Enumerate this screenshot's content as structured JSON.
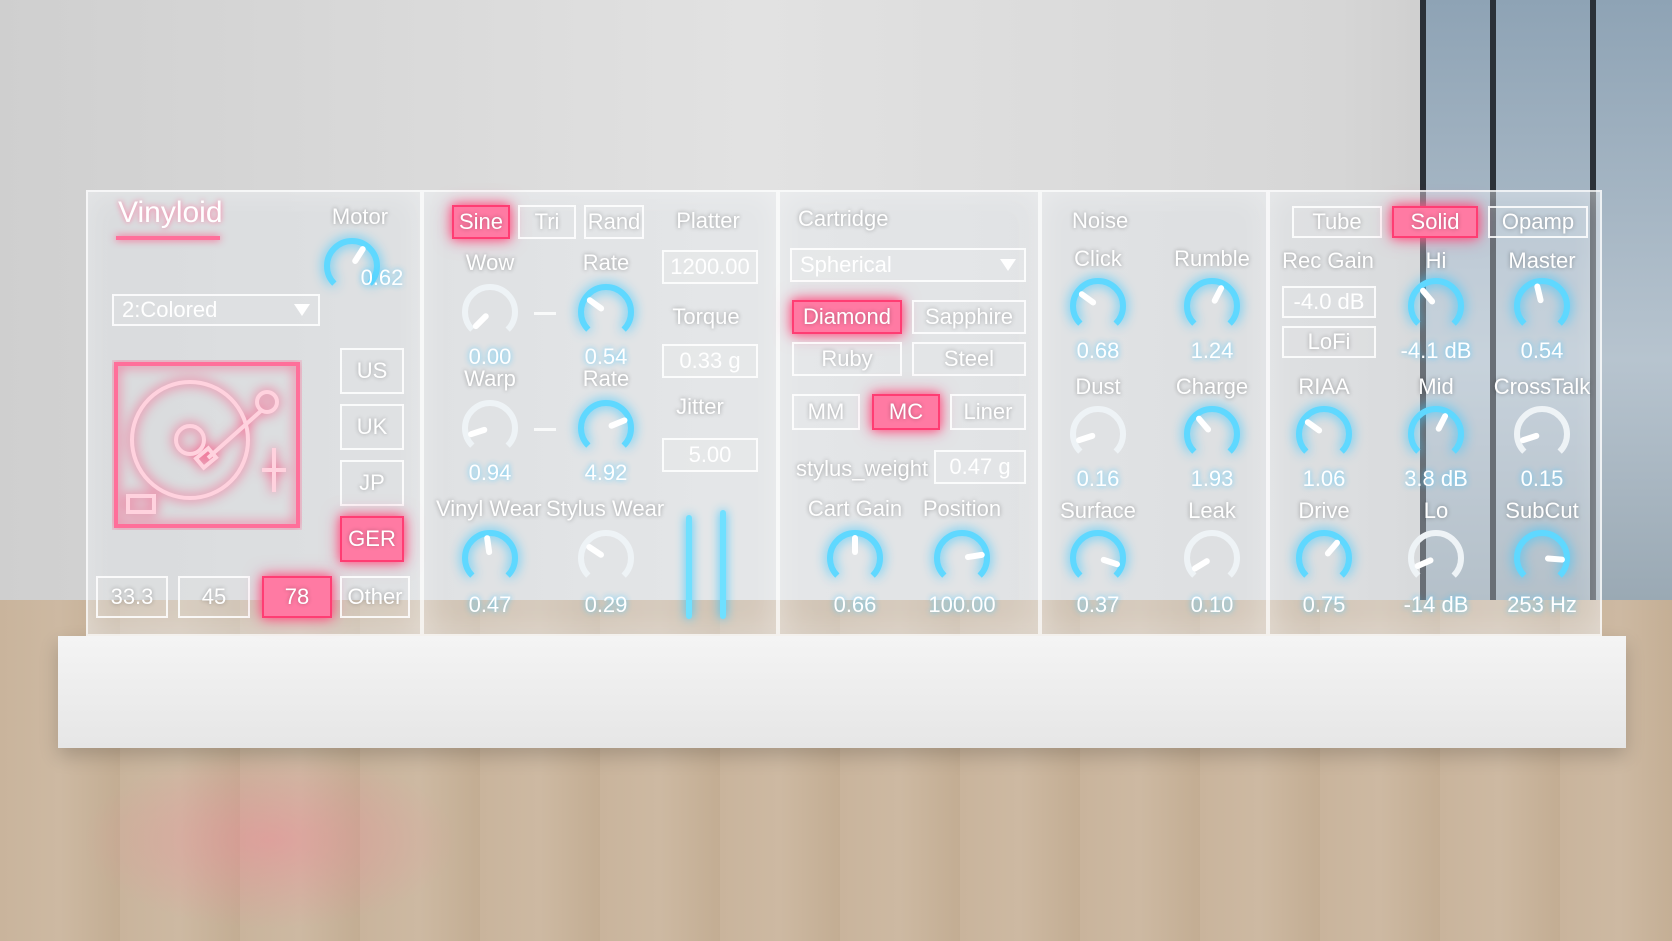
{
  "brand": {
    "title": "Vinyloid"
  },
  "motor": {
    "label": "Motor",
    "value": "0.62",
    "level": 0.62
  },
  "vinyl_type": {
    "selected": "2:Colored"
  },
  "region": {
    "buttons": [
      "US",
      "UK",
      "JP",
      "GER"
    ],
    "active": "GER"
  },
  "speed": {
    "buttons": [
      "33.3",
      "45",
      "78",
      "Other"
    ],
    "active": "78"
  },
  "lfo": {
    "buttons": [
      "Sine",
      "Tri",
      "Rand"
    ],
    "active": "Sine"
  },
  "platter": {
    "label": "Platter",
    "value": "1200.00",
    "torque_label": "Torque",
    "torque_value": "0.33 g",
    "jitter_label": "Jitter",
    "jitter_value": "5.00"
  },
  "wow": {
    "label": "Wow",
    "value": "0.00",
    "level": 0.0
  },
  "wow_rate": {
    "label": "Rate",
    "value": "0.54",
    "level": 0.3
  },
  "warp": {
    "label": "Warp",
    "value": "0.94",
    "level": 0.1
  },
  "warp_rate": {
    "label": "Rate",
    "value": "4.92",
    "level": 0.75
  },
  "vinyl_wear": {
    "label": "Vinyl Wear",
    "value": "0.47",
    "level": 0.47
  },
  "stylus_wear": {
    "label": "Stylus Wear",
    "value": "0.29",
    "level": 0.29
  },
  "cartridge": {
    "label": "Cartridge",
    "shape": "Spherical",
    "stylus_buttons": [
      "Diamond",
      "Sapphire",
      "Ruby",
      "Steel"
    ],
    "stylus_active": "Diamond",
    "type_buttons": [
      "MM",
      "MC",
      "Liner"
    ],
    "type_active": "MC",
    "weight_label": "stylus_weight",
    "weight_value": "0.47 g"
  },
  "cart_gain": {
    "label": "Cart Gain",
    "value": "0.66",
    "level": 0.5
  },
  "position": {
    "label": "Position",
    "value": "100.00",
    "level": 0.8
  },
  "noise": {
    "label": "Noise"
  },
  "click": {
    "label": "Click",
    "value": "0.68",
    "level": 0.3
  },
  "rumble": {
    "label": "Rumble",
    "value": "1.24",
    "level": 0.6
  },
  "dust": {
    "label": "Dust",
    "value": "0.16",
    "level": 0.1
  },
  "charge": {
    "label": "Charge",
    "value": "1.93",
    "level": 0.35
  },
  "surface": {
    "label": "Surface",
    "value": "0.37",
    "level": 0.9
  },
  "leak": {
    "label": "Leak",
    "value": "0.10",
    "level": 0.05
  },
  "circuit": {
    "buttons": [
      "Tube",
      "Solid",
      "Opamp"
    ],
    "active": "Solid"
  },
  "rec_gain": {
    "label": "Rec Gain",
    "value": "-4.0 dB",
    "lofi_label": "LoFi"
  },
  "hi": {
    "label": "Hi",
    "value": "-4.1 dB",
    "level": 0.35
  },
  "master": {
    "label": "Master",
    "value": "0.54",
    "level": 0.45
  },
  "riaa": {
    "label": "RIAA",
    "value": "1.06",
    "level": 0.3
  },
  "mid": {
    "label": "Mid",
    "value": "3.8 dB",
    "level": 0.6
  },
  "crosstalk": {
    "label": "CrossTalk",
    "value": "0.15",
    "level": 0.1
  },
  "drive": {
    "label": "Drive",
    "value": "0.75",
    "level": 0.65
  },
  "lo": {
    "label": "Lo",
    "value": "-14 dB",
    "level": 0.08
  },
  "subcut": {
    "label": "SubCut",
    "value": "253 Hz",
    "level": 0.85
  }
}
